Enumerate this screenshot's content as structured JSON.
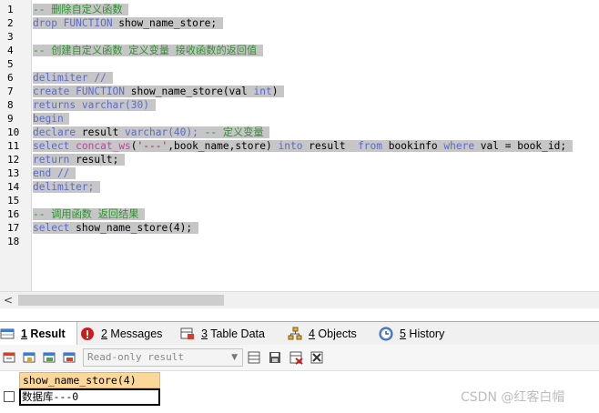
{
  "editor": {
    "line_numbers": [
      "1",
      "2",
      "3",
      "4",
      "5",
      "6",
      "7",
      "8",
      "9",
      "10",
      "11",
      "12",
      "13",
      "14",
      "15",
      "16",
      "17",
      "18"
    ],
    "lines": [
      [
        {
          "t": "-- 删除自定义函数",
          "c": "cm"
        }
      ],
      [
        {
          "t": "drop FUNCTION",
          "c": "kw"
        },
        {
          "t": " show_name_store;",
          "c": "tx"
        }
      ],
      [],
      [
        {
          "t": "-- 创建自定义函数 定义变量 接收函数的返回值",
          "c": "cm"
        }
      ],
      [],
      [
        {
          "t": "delimiter //",
          "c": "kw"
        }
      ],
      [
        {
          "t": "create FUNCTION",
          "c": "kw"
        },
        {
          "t": " show_name_store(val ",
          "c": "tx"
        },
        {
          "t": "int",
          "c": "kw"
        },
        {
          "t": ")",
          "c": "tx"
        }
      ],
      [
        {
          "t": "returns varchar(30)",
          "c": "kw"
        }
      ],
      [
        {
          "t": "begin",
          "c": "kw"
        }
      ],
      [
        {
          "t": "declare",
          "c": "kw"
        },
        {
          "t": " result ",
          "c": "tx"
        },
        {
          "t": "varchar(40);",
          "c": "kw"
        },
        {
          "t": " ",
          "c": "tx"
        },
        {
          "t": "-- 定义变量",
          "c": "cm"
        }
      ],
      [
        {
          "t": "select",
          "c": "kw"
        },
        {
          "t": " ",
          "c": "tx"
        },
        {
          "t": "concat_ws",
          "c": "fn"
        },
        {
          "t": "(",
          "c": "tx"
        },
        {
          "t": "'---'",
          "c": "str"
        },
        {
          "t": ",book_name,store) ",
          "c": "tx"
        },
        {
          "t": "into",
          "c": "kw"
        },
        {
          "t": " result  ",
          "c": "tx"
        },
        {
          "t": "from",
          "c": "kw"
        },
        {
          "t": " bookinfo ",
          "c": "tx"
        },
        {
          "t": "where",
          "c": "kw"
        },
        {
          "t": " val = book_id;",
          "c": "tx"
        }
      ],
      [
        {
          "t": "return",
          "c": "kw"
        },
        {
          "t": " result;",
          "c": "tx"
        }
      ],
      [
        {
          "t": "end //",
          "c": "kw"
        }
      ],
      [
        {
          "t": "delimiter;",
          "c": "kw"
        }
      ],
      [],
      [
        {
          "t": "-- 调用函数 返回结果",
          "c": "cm"
        }
      ],
      [
        {
          "t": "select",
          "c": "kw"
        },
        {
          "t": " show_name_store(4);",
          "c": "tx"
        }
      ],
      []
    ]
  },
  "scroll": {
    "left_arrow": "<"
  },
  "result_tabs": [
    {
      "num": "1",
      "label": " Result",
      "icon": "result-grid-icon",
      "active": true
    },
    {
      "num": "2",
      "label": " Messages",
      "icon": "messages-error-icon",
      "active": false
    },
    {
      "num": "3",
      "label": " Table Data",
      "icon": "table-data-icon",
      "active": false
    },
    {
      "num": "4",
      "label": " Objects",
      "icon": "objects-icon",
      "active": false
    },
    {
      "num": "5",
      "label": " History",
      "icon": "history-icon",
      "active": false
    }
  ],
  "toolbar": {
    "mode_select": "Read-only result",
    "buttons": [
      "export-icon",
      "copy-icon",
      "refresh-icon",
      "import-icon",
      "insert-row-icon",
      "save-icon",
      "delete-row-icon",
      "discard-icon"
    ]
  },
  "result_grid": {
    "column": "show_name_store(4)",
    "rows": [
      "数据库---0"
    ]
  },
  "watermark": "CSDN @红客白帽",
  "colors": {
    "keyword": "#5b6bcc",
    "comment": "#2f8f2f",
    "function": "#c03fa6",
    "string": "#9a2a2a",
    "selection": "#c6c6c6",
    "header": "#fbd79a"
  }
}
